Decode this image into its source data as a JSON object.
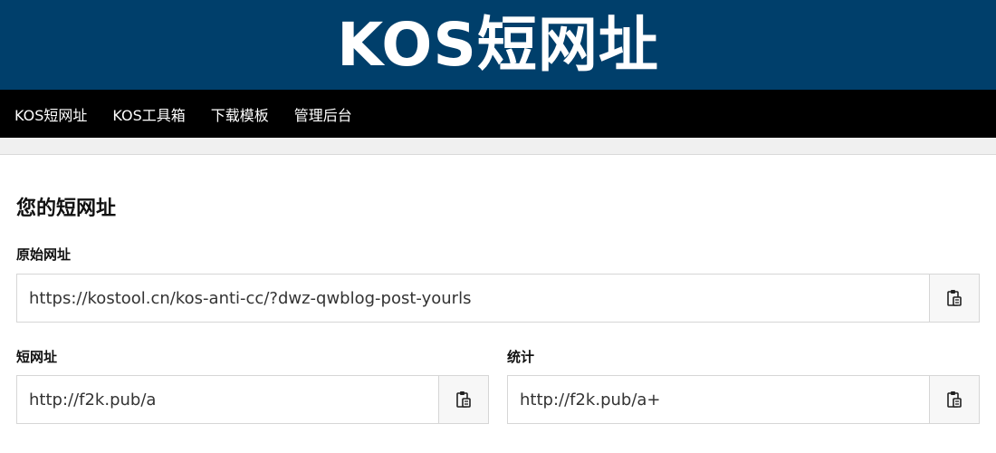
{
  "header": {
    "title": "KOS短网址"
  },
  "nav": {
    "items": [
      {
        "label": "KOS短网址"
      },
      {
        "label": "KOS工具箱"
      },
      {
        "label": "下载模板"
      },
      {
        "label": "管理后台"
      }
    ]
  },
  "main": {
    "heading": "您的短网址",
    "original": {
      "label": "原始网址",
      "value": "https://kostool.cn/kos-anti-cc/?dwz-qwblog-post-yourls",
      "copy_icon": "clipboard-icon"
    },
    "short": {
      "label": "短网址",
      "value": "http://f2k.pub/a",
      "copy_icon": "clipboard-icon"
    },
    "stats": {
      "label": "统计",
      "value": "http://f2k.pub/a+",
      "copy_icon": "clipboard-icon"
    }
  },
  "colors": {
    "banner": "#003f6b",
    "navbar": "#000000"
  }
}
